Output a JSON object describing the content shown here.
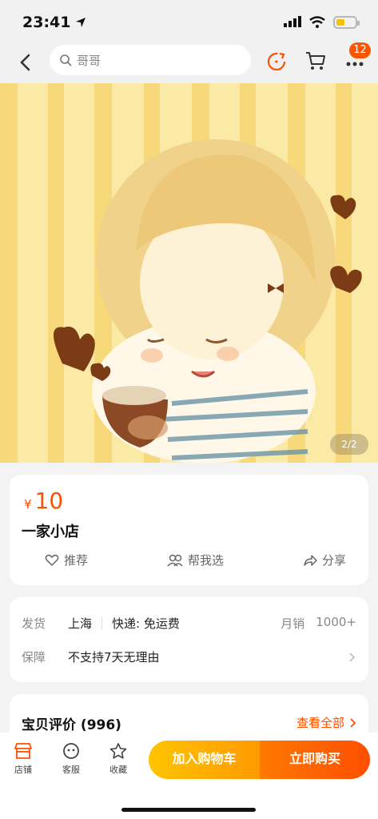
{
  "status": {
    "time": "23:41",
    "battery_level": 0.45
  },
  "nav": {
    "search_text": "哥哥",
    "more_badge": "12"
  },
  "gallery": {
    "indicator": "2/2"
  },
  "product": {
    "currency": "¥",
    "price": "10",
    "shop_name": "一家小店",
    "actions": [
      "推荐",
      "帮我选",
      "分享"
    ]
  },
  "shipping": {
    "ship_label": "发货",
    "origin": "上海",
    "delivery": "快递: 免运费",
    "sales_label": "月销",
    "sales_value": "1000+",
    "guarantee_label": "保障",
    "guarantee_value": "不支持7天无理由"
  },
  "reviews": {
    "title": "宝贝评价 (996)",
    "view_all": "查看全部"
  },
  "bottom_bar": {
    "tabs": [
      "店铺",
      "客服",
      "收藏"
    ],
    "add_to_cart": "加入购物车",
    "buy_now": "立即购买"
  },
  "colors": {
    "accent": "#ff5000",
    "cart_yellow": "#ffc400",
    "buy_orange": "#ff4e00"
  }
}
